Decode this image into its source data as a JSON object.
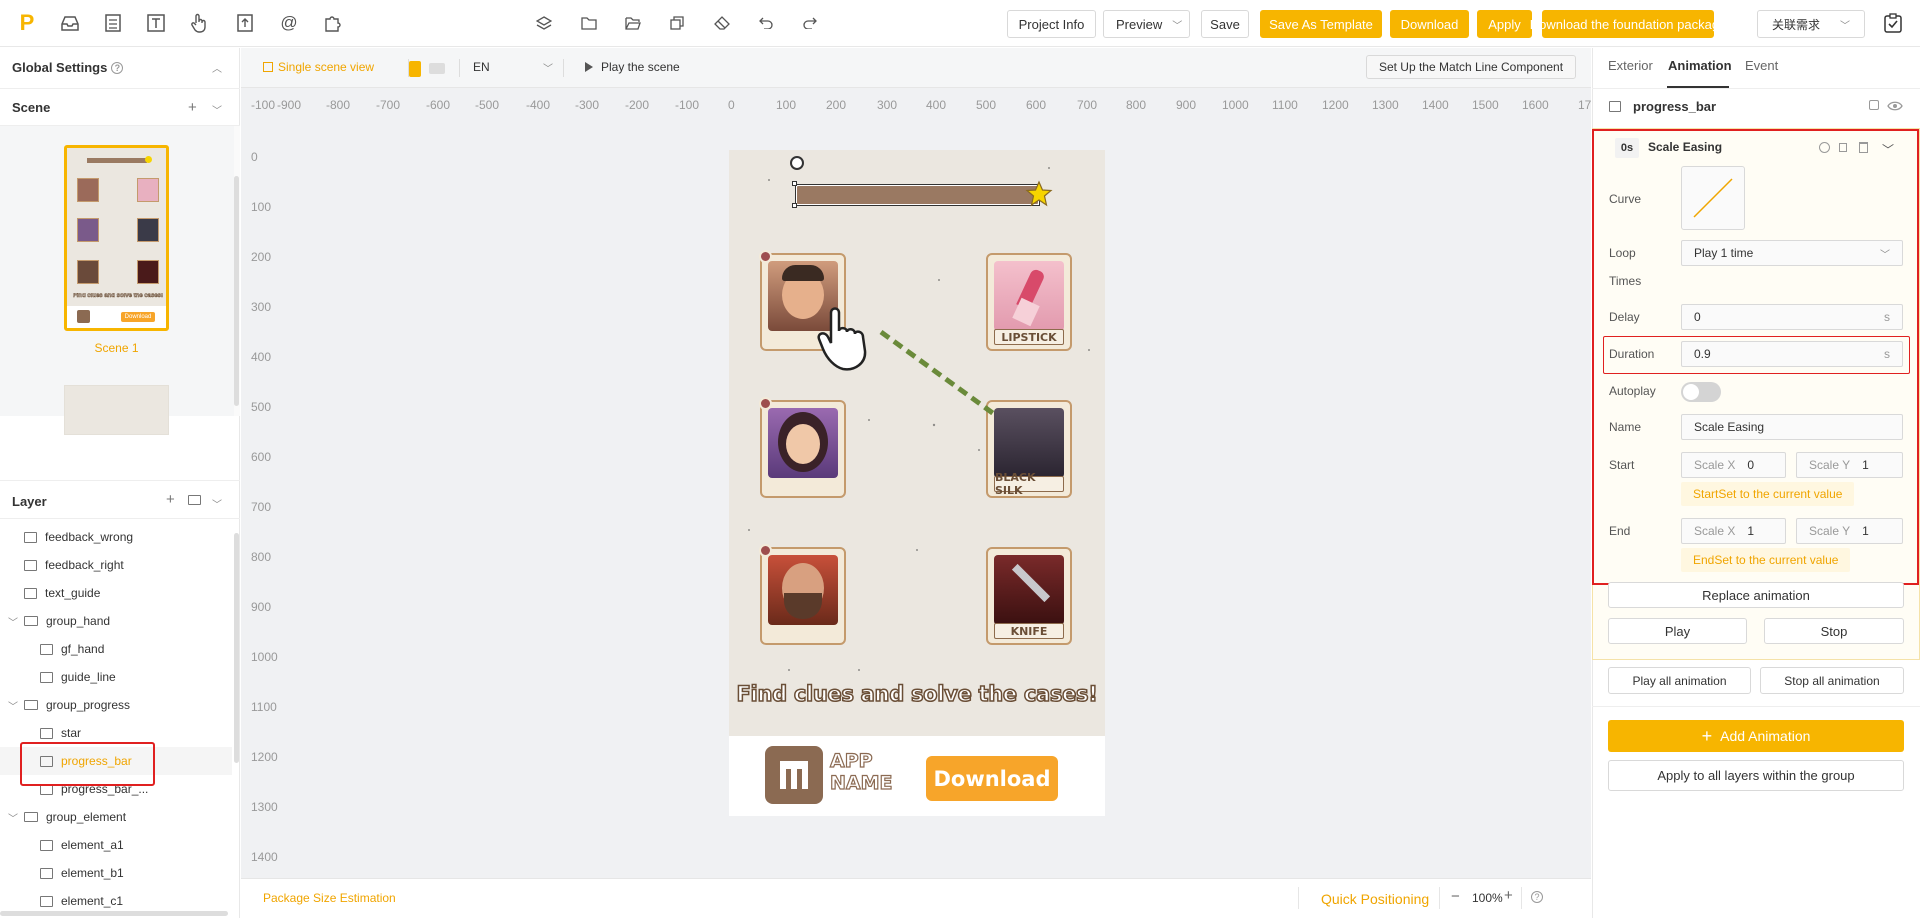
{
  "toolbar": {
    "left_icons": [
      "logo-icon",
      "inbox-icon",
      "grid-icon",
      "text-icon",
      "hand-icon",
      "upload-icon",
      "at-icon",
      "puzzle-icon"
    ],
    "center_icons": [
      "layers-icon",
      "folder-icon",
      "folder-open-icon",
      "copy-icon",
      "eraser-icon",
      "undo-icon",
      "redo-icon"
    ],
    "project_info": "Project Info",
    "preview": "Preview",
    "save": "Save",
    "save_as_template": "Save As Template",
    "download": "Download",
    "apply": "Apply",
    "download_foundation": "Download the foundation package",
    "related_requirements": "关联需求"
  },
  "left_panel": {
    "global_settings": "Global Settings",
    "scene_title": "Scene",
    "scene1_label": "Scene 1",
    "layer_title": "Layer",
    "layers": [
      {
        "label": "feedback_wrong",
        "type": "image",
        "indent": 1
      },
      {
        "label": "feedback_right",
        "type": "image",
        "indent": 1
      },
      {
        "label": "text_guide",
        "type": "text",
        "indent": 1
      },
      {
        "label": "group_hand",
        "type": "group",
        "indent": 0
      },
      {
        "label": "gf_hand",
        "type": "image",
        "indent": 2
      },
      {
        "label": "guide_line",
        "type": "image",
        "indent": 2
      },
      {
        "label": "group_progress",
        "type": "group",
        "indent": 0
      },
      {
        "label": "star",
        "type": "image",
        "indent": 2
      },
      {
        "label": "progress_bar",
        "type": "image",
        "indent": 2,
        "selected": true
      },
      {
        "label": "progress_bar_...",
        "type": "image",
        "indent": 2
      },
      {
        "label": "group_element",
        "type": "group",
        "indent": 0
      },
      {
        "label": "element_a1",
        "type": "image",
        "indent": 2
      },
      {
        "label": "element_b1",
        "type": "image",
        "indent": 2
      },
      {
        "label": "element_c1",
        "type": "image",
        "indent": 2
      }
    ]
  },
  "canvas": {
    "single_scene_view": "Single scene view",
    "language": "EN",
    "play_scene": "Play the scene",
    "match_line_btn": "Set Up the Match Line Component",
    "ruler_x": [
      "-100",
      "-900",
      "-800",
      "-700",
      "-600",
      "-500",
      "-400",
      "-300",
      "-200",
      "-100",
      "0",
      "100",
      "200",
      "300",
      "400",
      "500",
      "600",
      "700",
      "800",
      "900",
      "1000",
      "1100",
      "1200",
      "1300",
      "1400",
      "1500",
      "1600",
      "17"
    ],
    "ruler_y": [
      "0",
      "100",
      "200",
      "300",
      "400",
      "500",
      "600",
      "700",
      "800",
      "900",
      "1000",
      "1100",
      "1200",
      "1300",
      "1400"
    ],
    "package_size": "Package Size Estimation",
    "quick_positioning": "Quick Positioning",
    "zoom": "100%"
  },
  "phone": {
    "cards_right": [
      "LIPSTICK",
      "BLACK SILK",
      "KNIFE"
    ],
    "caption": "Find clues and solve the cases!",
    "app_name_line1": "APP",
    "app_name_line2": "NAME",
    "download_btn": "Download",
    "thumb_caption": "Find clues and solve the cases!",
    "thumb_download": "Download"
  },
  "right_panel": {
    "tabs": [
      "Exterior",
      "Animation",
      "Event"
    ],
    "active_tab": "Animation",
    "layer_name": "progress_bar",
    "anim_time": "0s",
    "anim_title": "Scale Easing",
    "curve_label": "Curve",
    "loop_label": "Loop",
    "loop_value": "Play 1 time",
    "times_label": "Times",
    "delay_label": "Delay",
    "delay_value": "0",
    "duration_label": "Duration",
    "duration_value": "0.9",
    "unit_s": "s",
    "autoplay_label": "Autoplay",
    "name_label": "Name",
    "name_value": "Scale Easing",
    "start_label": "Start",
    "start_scale_x_label": "Scale X",
    "start_scale_x": "0",
    "start_scale_y_label": "Scale Y",
    "start_scale_y": "1",
    "start_set_btn": "StartSet to the current value",
    "end_label": "End",
    "end_scale_x_label": "Scale X",
    "end_scale_x": "1",
    "end_scale_y_label": "Scale Y",
    "end_scale_y": "1",
    "end_set_btn": "EndSet to the current value",
    "replace_animation": "Replace animation",
    "play": "Play",
    "stop": "Stop",
    "play_all": "Play all animation",
    "stop_all": "Stop all animation",
    "add_animation": "Add Animation",
    "apply_group": "Apply to all layers within the group"
  },
  "colors": {
    "accent": "#f7b500",
    "highlight": "#e02020"
  }
}
